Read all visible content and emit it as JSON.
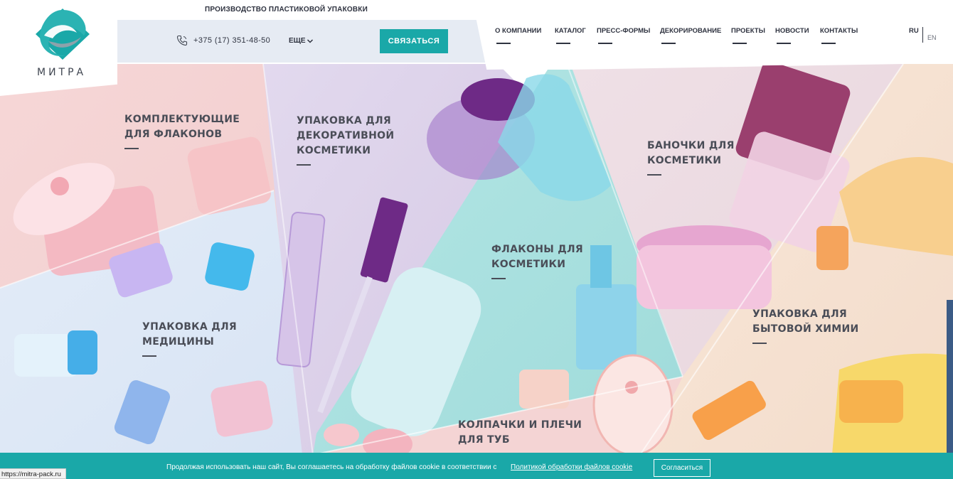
{
  "header": {
    "logo_text": "МИТРА",
    "tagline": "ПРОИЗВОДСТВО ПЛАСТИКОВОЙ УПАКОВКИ",
    "phone": "+375 (17) 351-48-50",
    "more_label": "ЕЩЕ",
    "contact_button": "СВЯЗАТЬСЯ",
    "nav": [
      {
        "label": "О КОМПАНИИ"
      },
      {
        "label": "КАТАЛОГ"
      },
      {
        "label": "ПРЕСС-ФОРМЫ"
      },
      {
        "label": "ДЕКОРИРОВАНИЕ"
      },
      {
        "label": "ПРОЕКТЫ"
      },
      {
        "label": "НОВОСТИ"
      },
      {
        "label": "КОНТАКТЫ"
      }
    ],
    "lang_active": "RU",
    "lang_other": "EN"
  },
  "categories": [
    {
      "title": "КОМПЛЕКТУЮЩИЕ\nДЛЯ ФЛАКОНОВ"
    },
    {
      "title": "УПАКОВКА ДЛЯ\nДЕКОРАТИВНОЙ\nКОСМЕТИКИ"
    },
    {
      "title": "БАНОЧКИ ДЛЯ\nКОСМЕТИКИ"
    },
    {
      "title": "ФЛАКОНЫ ДЛЯ\nКОСМЕТИКИ"
    },
    {
      "title": "УПАКОВКА ДЛЯ\nМЕДИЦИНЫ"
    },
    {
      "title": "УПАКОВКА ДЛЯ\nБЫТОВОЙ ХИМИИ"
    },
    {
      "title": "КОЛПАЧКИ И ПЛЕЧИ\nДЛЯ ТУБ"
    }
  ],
  "cookie": {
    "text": "Продолжая использовать наш сайт, Вы соглашаетесь на обработку файлов cookie в соответствии с",
    "link": "Политикой обработки файлов cookie",
    "accept": "Согласиться"
  },
  "status_bar": {
    "url": "https://mitra-pack.ru"
  },
  "colors": {
    "accent": "#1aa8a8",
    "text": "#4a4d57",
    "pink_panel": "#f4d3d3",
    "lilac_panel": "#ddd4ea",
    "mint_panel": "#a9e1e0",
    "blue_panel": "#dde8f6",
    "peach_panel": "#f6e2d3"
  }
}
